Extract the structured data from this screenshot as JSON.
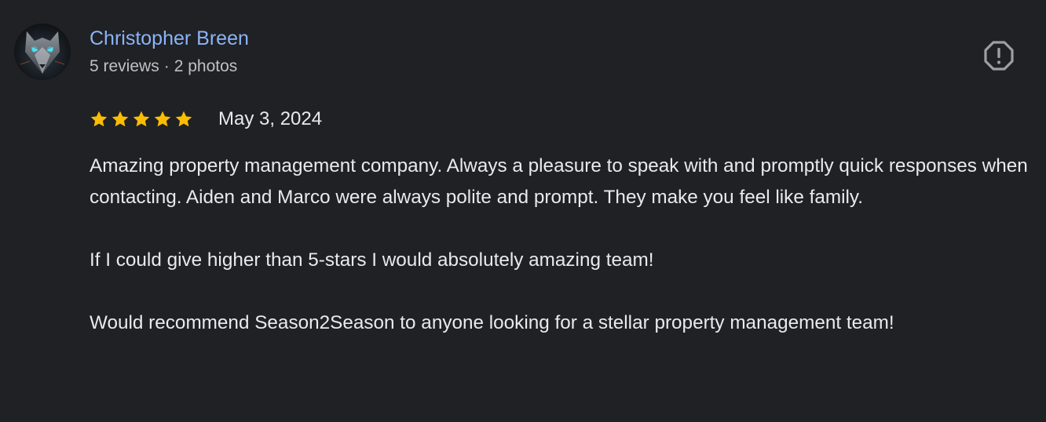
{
  "review": {
    "author": {
      "name": "Christopher Breen",
      "reviews_count": "5 reviews",
      "separator": "·",
      "photos_count": "2 photos",
      "avatar_icon": "wolf-avatar-icon"
    },
    "report_icon": "flag-report-icon",
    "rating": {
      "stars": 5,
      "max_stars": 5,
      "star_color": "#fbbc04"
    },
    "date": "May 3, 2024",
    "paragraphs": [
      "Amazing property management company. Always a pleasure to speak with and promptly quick responses when contacting. Aiden and Marco were always polite and prompt. They make you feel like family.",
      "If I could give higher than 5-stars I would absolutely amazing team!",
      "Would recommend Season2Season to anyone looking for a stellar property management team!"
    ]
  },
  "colors": {
    "background": "#202124",
    "author_name": "#8ab4f8",
    "meta_text": "#bdc1c6",
    "body_text": "#e8eaed",
    "icon": "#9aa0a6"
  }
}
